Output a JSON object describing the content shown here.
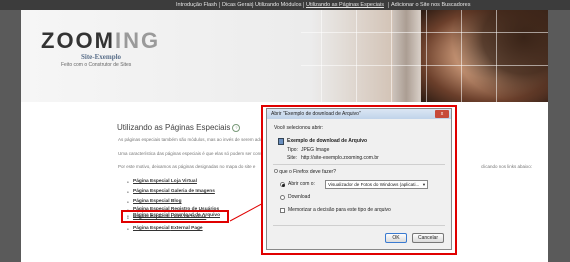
{
  "topnav": {
    "items": [
      {
        "label": "Introdução Flash"
      },
      {
        "label": "Dicas Gerais"
      },
      {
        "label": "Utilizando Módulos"
      },
      {
        "label": "Utilizando as Páginas Especiais"
      },
      {
        "label": "Adicionar o Site nos Buscadores"
      }
    ]
  },
  "header": {
    "logo_left": "ZOOM",
    "logo_right": "ING",
    "site_title": "Site-Exemplo",
    "site_subtitle": "Feito com o Construtor de Sites"
  },
  "content": {
    "heading": "Utilizando as Páginas Especiais",
    "heading_icon": "help-icon",
    "para1": "As páginas especiais também são módulos, mas ao invés de serem ado",
    "para2": "Uma característica das páginas especiais é que elas só podem ser cons",
    "para3": "Por este motivo, deixamos as páginas designadas no mapa do site e",
    "para3_right": "clicando nos links abaixo:",
    "links": [
      {
        "prefix": "Página Especial ",
        "label": "Loja Virtual"
      },
      {
        "prefix": "Página Especial ",
        "label": "Galeria de Imagens"
      },
      {
        "prefix": "Página Especial ",
        "label": "Blog"
      },
      {
        "prefix": "Página Especial ",
        "label": "Registro de Usuários"
      },
      {
        "prefix": "Página Especial ",
        "label": "Livro de Visitas"
      },
      {
        "prefix": "Página Especial ",
        "label": "Download de Arquivo"
      },
      {
        "prefix": "Página Especial ",
        "label": "External Page"
      }
    ]
  },
  "dialog": {
    "title": "Abrir \"Exemplo de download de Arquivo\"",
    "close_label": "x",
    "intro": "Você selecionou abrir:",
    "file_name": "Exemplo de download de Arquivo",
    "type_label": "Tipo:",
    "type_value": "JPEG Image",
    "site_label": "Site:",
    "site_value": "http://site-exemplo.zooming.com.br",
    "question": "O que o Firefox deve fazer?",
    "open_with_label": "Abrir com o:",
    "open_with_value": "Visualizador de Fotos do Windows (aplicati...",
    "download_label": "Download",
    "remember_label": "Memorizar a decisão para este tipo de arquivo",
    "ok_label": "OK",
    "cancel_label": "Cancelar"
  },
  "colors": {
    "highlight": "#e00000",
    "topnav_bg": "#3c3c3c",
    "page_bg": "#5a5a5a"
  }
}
